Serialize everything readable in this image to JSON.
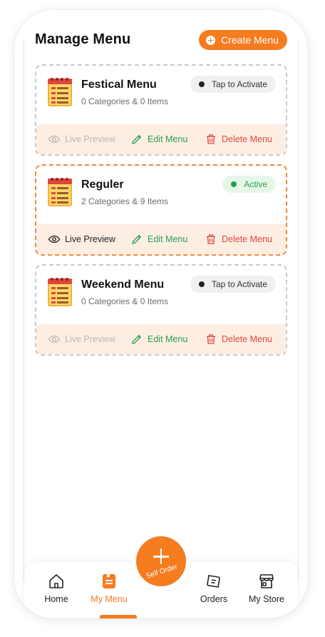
{
  "header": {
    "title": "Manage Menu",
    "create_button_label": "Create Menu"
  },
  "menus": [
    {
      "name": "Festical Menu",
      "summary": "0 Categories & 0 Items",
      "status": "Tap to Activate",
      "is_active": false,
      "preview_label": "Live Preview",
      "preview_enabled": false,
      "edit_label": "Edit Menu",
      "delete_label": "Delete Menu"
    },
    {
      "name": "Reguler",
      "summary": "2 Categories & 9 Items",
      "status": "Active",
      "is_active": true,
      "preview_label": "Live Preview",
      "preview_enabled": true,
      "edit_label": "Edit Menu",
      "delete_label": "Delete Menu"
    },
    {
      "name": "Weekend Menu",
      "summary": "0 Categories & 0 Items",
      "status": "Tap to Activate",
      "is_active": false,
      "preview_label": "Live Preview",
      "preview_enabled": false,
      "edit_label": "Edit Menu",
      "delete_label": "Delete Menu"
    }
  ],
  "fab": {
    "label": "Self Order",
    "icon": "plus-icon"
  },
  "tabbar": {
    "items": [
      {
        "label": "Home",
        "icon": "home-icon",
        "selected": false
      },
      {
        "label": "My Menu",
        "icon": "menu-book-icon",
        "selected": true
      },
      {
        "label": "Orders",
        "icon": "orders-icon",
        "selected": false
      },
      {
        "label": "My Store",
        "icon": "store-icon",
        "selected": false
      }
    ]
  },
  "colors": {
    "accent": "#f57c1f",
    "active_green": "#22a04a",
    "delete_red": "#e0453a",
    "action_bar_bg": "#fdeee3"
  }
}
